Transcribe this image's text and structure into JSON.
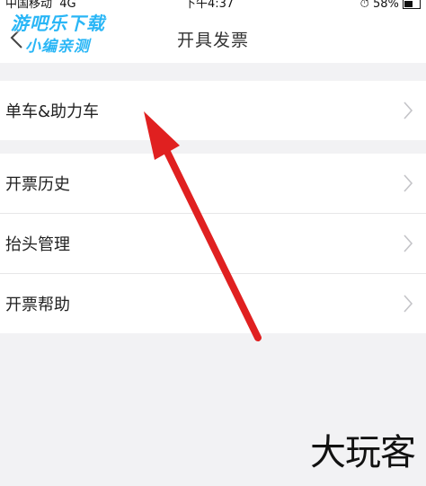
{
  "status_bar": {
    "carrier": "中国移动",
    "network": "4G",
    "time": "下午4:37",
    "battery": "58%"
  },
  "nav": {
    "title": "开具发票",
    "back_icon": "chevron-left-icon"
  },
  "watermark_top": {
    "line1": "游吧乐下载",
    "line2": "小编亲测"
  },
  "groups": [
    {
      "items": [
        {
          "label": "单车&助力车",
          "icon": "chevron-right-icon"
        }
      ]
    },
    {
      "items": [
        {
          "label": "开票历史",
          "icon": "chevron-right-icon"
        },
        {
          "label": "抬头管理",
          "icon": "chevron-right-icon"
        },
        {
          "label": "开票帮助",
          "icon": "chevron-right-icon"
        }
      ]
    }
  ],
  "watermark_bottom": "大玩客",
  "colors": {
    "background": "#f2f2f4",
    "card": "#ffffff",
    "annotation_arrow": "#e02020",
    "watermark_blue": "#29b6f6"
  }
}
